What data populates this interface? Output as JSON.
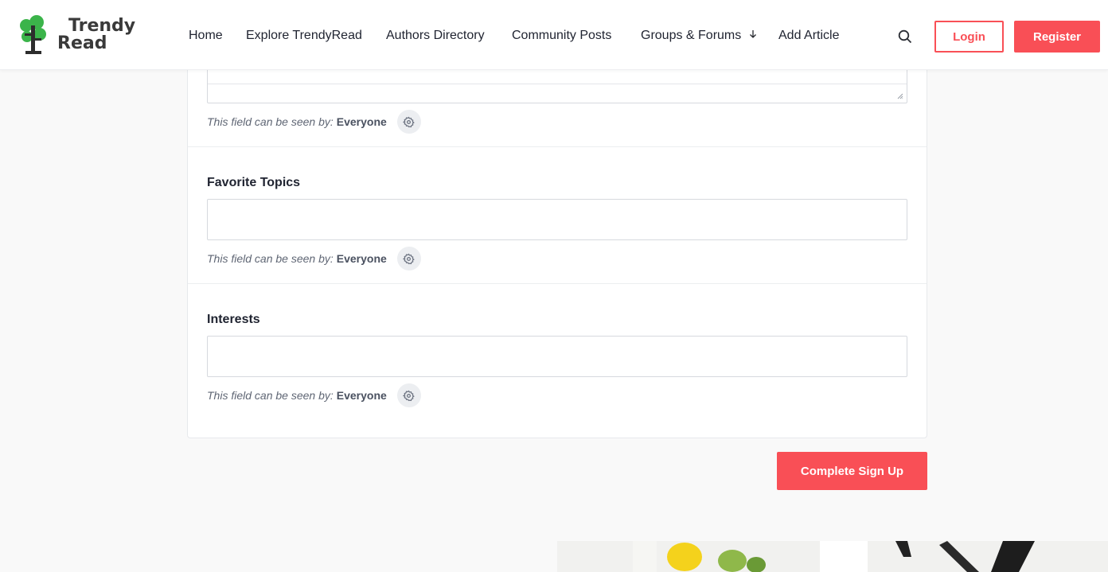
{
  "brand": {
    "name_line1": "Trendy",
    "name_line2": "Read",
    "colors": {
      "accent": "#f94f56",
      "logo_green": "#3bb44a"
    }
  },
  "nav": {
    "items": [
      {
        "label": "Home"
      },
      {
        "label": "Explore TrendyRead"
      },
      {
        "label": "Authors Directory"
      },
      {
        "label": "Community Posts"
      },
      {
        "label": "Groups & Forums",
        "has_dropdown": true
      },
      {
        "label": "Add Article"
      }
    ],
    "search_icon": "search-icon",
    "login_label": "Login",
    "register_label": "Register"
  },
  "form": {
    "visibility_prefix": "This field can be seen by:",
    "fields": [
      {
        "label": "",
        "type": "textarea",
        "value": "",
        "visibility": "Everyone"
      },
      {
        "label": "Favorite Topics",
        "type": "text",
        "value": "",
        "visibility": "Everyone"
      },
      {
        "label": "Interests",
        "type": "text",
        "value": "",
        "visibility": "Everyone"
      }
    ],
    "submit_label": "Complete Sign Up"
  }
}
